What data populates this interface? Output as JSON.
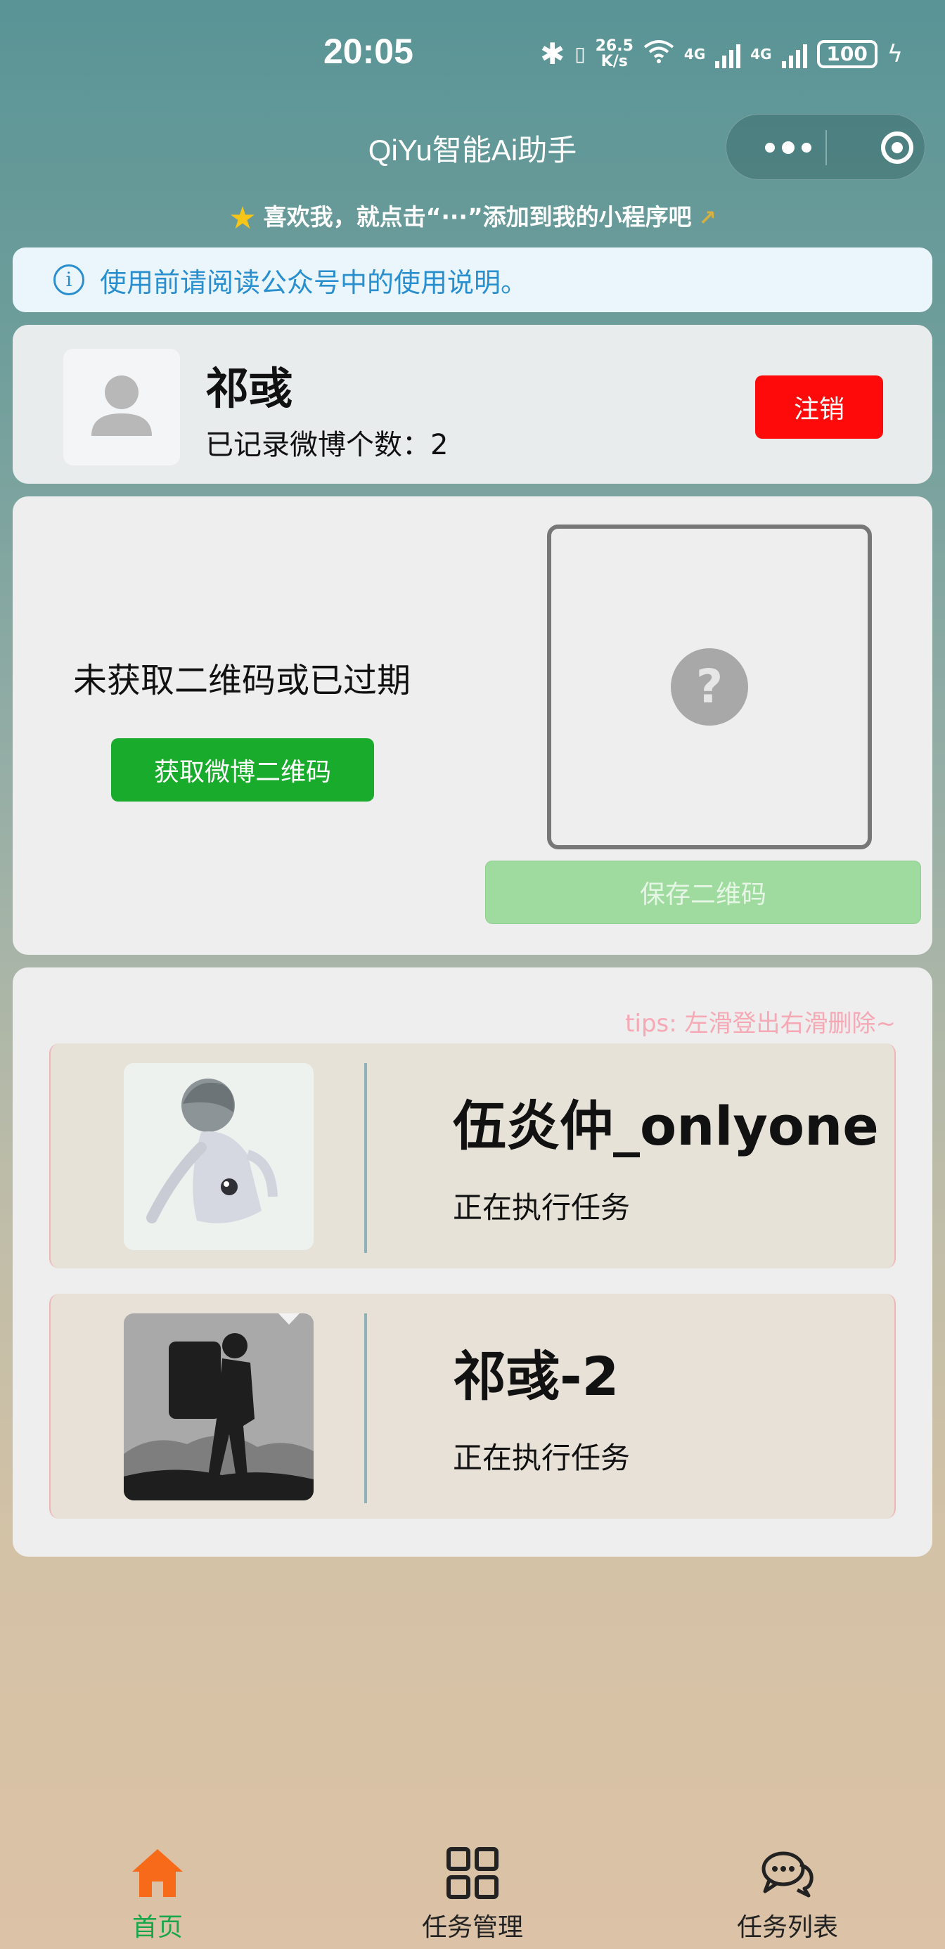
{
  "status_bar": {
    "time": "20:05",
    "net_speed_value": "26.5",
    "net_speed_unit": "K/s",
    "sim1": "4G",
    "sim2": "4G",
    "battery": "100"
  },
  "nav": {
    "title": "QiYu智能Ai助手"
  },
  "add_hint": "喜欢我，就点击“···”添加到我的小程序吧",
  "notice": {
    "text": "使用前请阅读公众号中的使用说明。"
  },
  "user": {
    "name": "祁彧",
    "count_label": "已记录微博个数：2",
    "logout_label": "注销"
  },
  "qr": {
    "status_text": "未获取二维码或已过期",
    "get_button": "获取微博二维码",
    "placeholder": "?",
    "save_button": "保存二维码"
  },
  "accounts": {
    "tips": "tips: 左滑登出右滑删除~",
    "items": [
      {
        "name": "伍炎仲_onlyone",
        "status": "正在执行任务"
      },
      {
        "name": "祁彧-2",
        "status": "正在执行任务"
      }
    ]
  },
  "tabbar": {
    "items": [
      {
        "label": "首页",
        "icon": "home-icon",
        "active": true
      },
      {
        "label": "任务管理",
        "icon": "grid-icon",
        "active": false
      },
      {
        "label": "任务列表",
        "icon": "chat-icon",
        "active": false
      }
    ]
  },
  "colors": {
    "logout": "#ff0a0a",
    "primary_green": "#19ab2b",
    "active_tab": "#19a64a",
    "home_icon": "#f76a1a",
    "notice_text": "#2a8fcf",
    "tips_text": "#f6a8b5"
  }
}
